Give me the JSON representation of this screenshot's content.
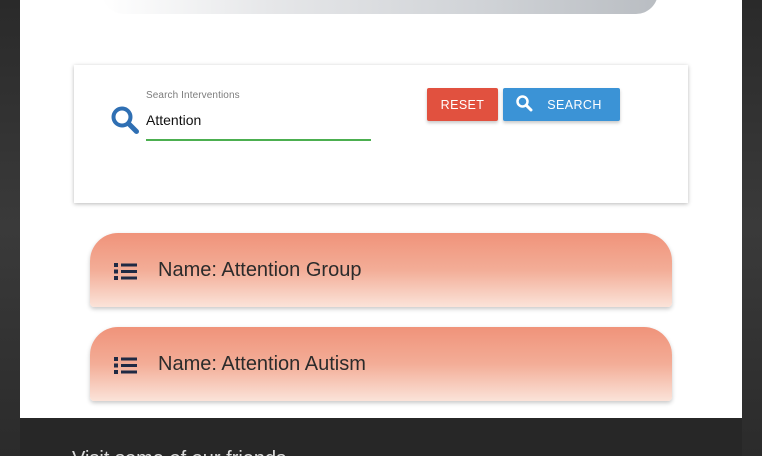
{
  "search": {
    "label": "Search Interventions",
    "value": "Attention",
    "reset_label": "RESET",
    "search_label": "SEARCH"
  },
  "results": [
    {
      "text": "Name: Attention Group"
    },
    {
      "text": "Name: Attention Autism"
    }
  ],
  "footer": {
    "text": "Visit some of our friends"
  },
  "colors": {
    "reset": "#e1513f",
    "search": "#3b93d6",
    "search_icon": "#2f6fb3",
    "input_underline": "#4caf50",
    "result_card_top": "#f0937a"
  },
  "icons": {
    "search": "search-icon",
    "list": "list-icon"
  }
}
